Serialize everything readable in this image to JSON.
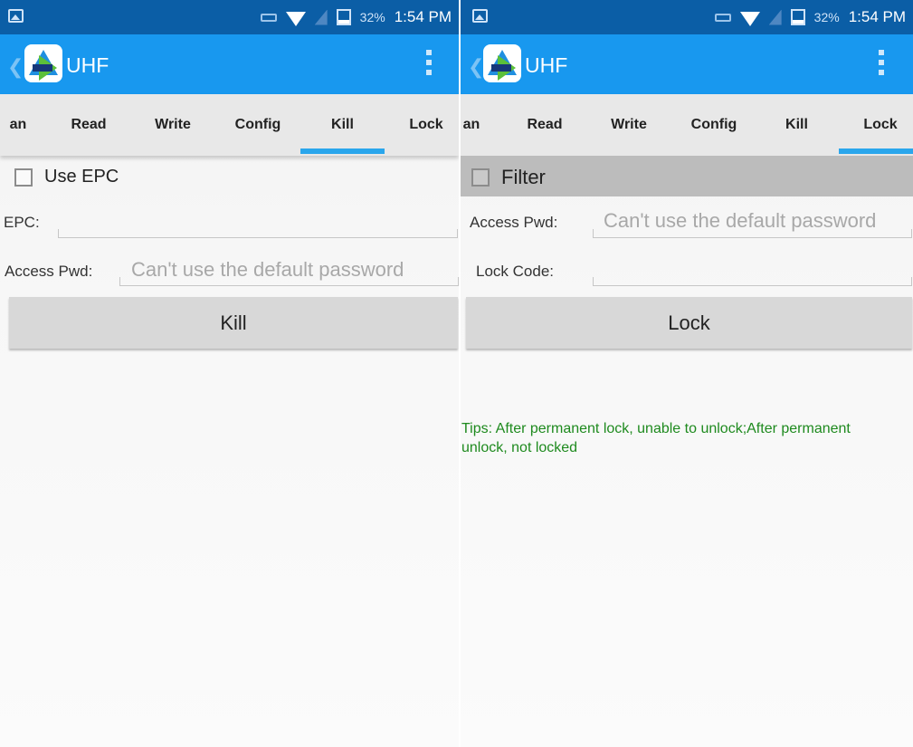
{
  "left": {
    "status": {
      "battery": "32%",
      "time": "1:54 PM"
    },
    "app_title": "UHF",
    "tabs": [
      "an",
      "Read",
      "Write",
      "Config",
      "Kill",
      "Lock"
    ],
    "active_tab": "Kill",
    "use_epc_label": "Use EPC",
    "epc_label": "EPC:",
    "epc_value": "",
    "access_pwd_label": "Access Pwd:",
    "access_pwd_placeholder": "Can't use the default password",
    "kill_button": "Kill"
  },
  "right": {
    "status": {
      "battery": "32%",
      "time": "1:54 PM"
    },
    "app_title": "UHF",
    "tabs": [
      "an",
      "Read",
      "Write",
      "Config",
      "Kill",
      "Lock"
    ],
    "active_tab": "Lock",
    "filter_label": "Filter",
    "access_pwd_label": "Access Pwd:",
    "access_pwd_placeholder": "Can't use the default password",
    "lock_code_label": "Lock Code:",
    "lock_code_value": "",
    "lock_button": "Lock",
    "tips": "Tips: After permanent lock, unable to unlock;After permanent unlock, not locked"
  },
  "colors": {
    "status_bar": "#0b5ea6",
    "app_bar": "#1898ef",
    "tab_indicator": "#2aa6ec",
    "tips_text": "#1e8a1e"
  }
}
